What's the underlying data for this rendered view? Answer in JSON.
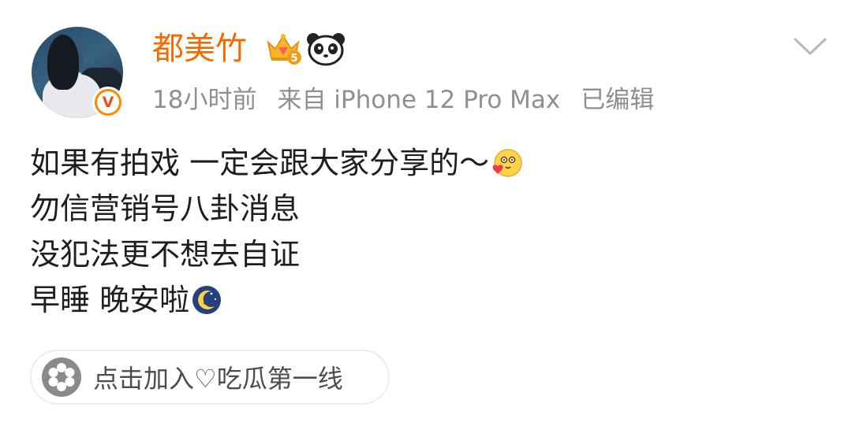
{
  "post": {
    "username": "都美竹",
    "time": "18小时前",
    "source": "来自 iPhone 12 Pro Max",
    "edited": "已编辑",
    "lines": [
      "如果有拍戏 一定会跟大家分享的～",
      "勿信营销号八卦消息",
      "没犯法更不想去自证",
      "早睡 晚安啦"
    ],
    "topic": "点击加入♡吃瓜第一线"
  },
  "icons": {
    "verified": "verified-v-badge-icon",
    "crown": "vip-crown-level-5-icon",
    "panda": "panda-icon",
    "more": "chevron-down-icon",
    "emoji_love": "blushing-heart-emoji-icon",
    "emoji_night": "moon-night-emoji-icon",
    "topic": "group-fan-icon"
  },
  "colors": {
    "username": "#f56a00",
    "meta": "#8f8f8f",
    "verified": "#ff8a00"
  },
  "badge_level": "5"
}
